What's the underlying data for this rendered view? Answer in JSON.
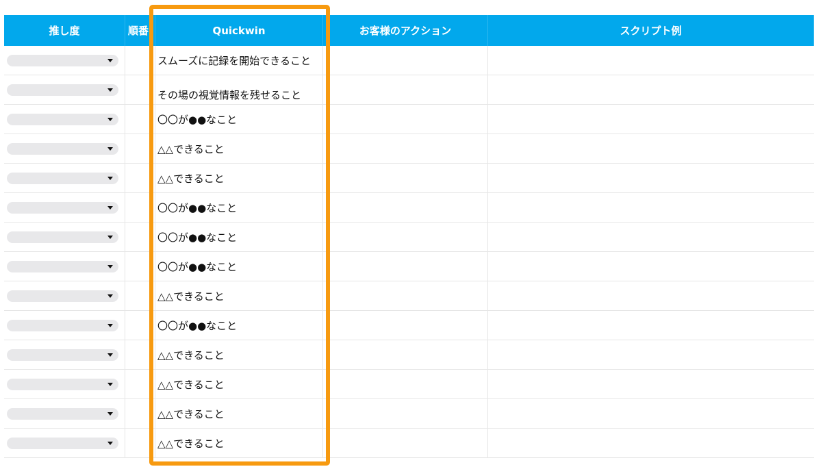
{
  "columns": {
    "recommendation": "推し度",
    "order": "順番",
    "quickwin": "Quickwin",
    "customer_action": "お客様のアクション",
    "script_example": "スクリプト例"
  },
  "rows": [
    {
      "quickwin": "スムーズに記録を開始できること",
      "select_value": ""
    },
    {
      "quickwin": "その場の視覚情報を残せること",
      "select_value": ""
    },
    {
      "quickwin": "〇〇が●●なこと",
      "select_value": ""
    },
    {
      "quickwin": "△△できること",
      "select_value": ""
    },
    {
      "quickwin": "△△できること",
      "select_value": ""
    },
    {
      "quickwin": "〇〇が●●なこと",
      "select_value": ""
    },
    {
      "quickwin": "〇〇が●●なこと",
      "select_value": ""
    },
    {
      "quickwin": "〇〇が●●なこと",
      "select_value": ""
    },
    {
      "quickwin": "△△できること",
      "select_value": ""
    },
    {
      "quickwin": "〇〇が●●なこと",
      "select_value": ""
    },
    {
      "quickwin": "△△できること",
      "select_value": ""
    },
    {
      "quickwin": "△△できること",
      "select_value": ""
    },
    {
      "quickwin": "△△できること",
      "select_value": ""
    },
    {
      "quickwin": "△△できること",
      "select_value": ""
    }
  ],
  "colors": {
    "header_bg": "#02a8ec",
    "highlight_border": "#f79a10"
  },
  "icons": {
    "dropdown": "caret-down-icon"
  }
}
